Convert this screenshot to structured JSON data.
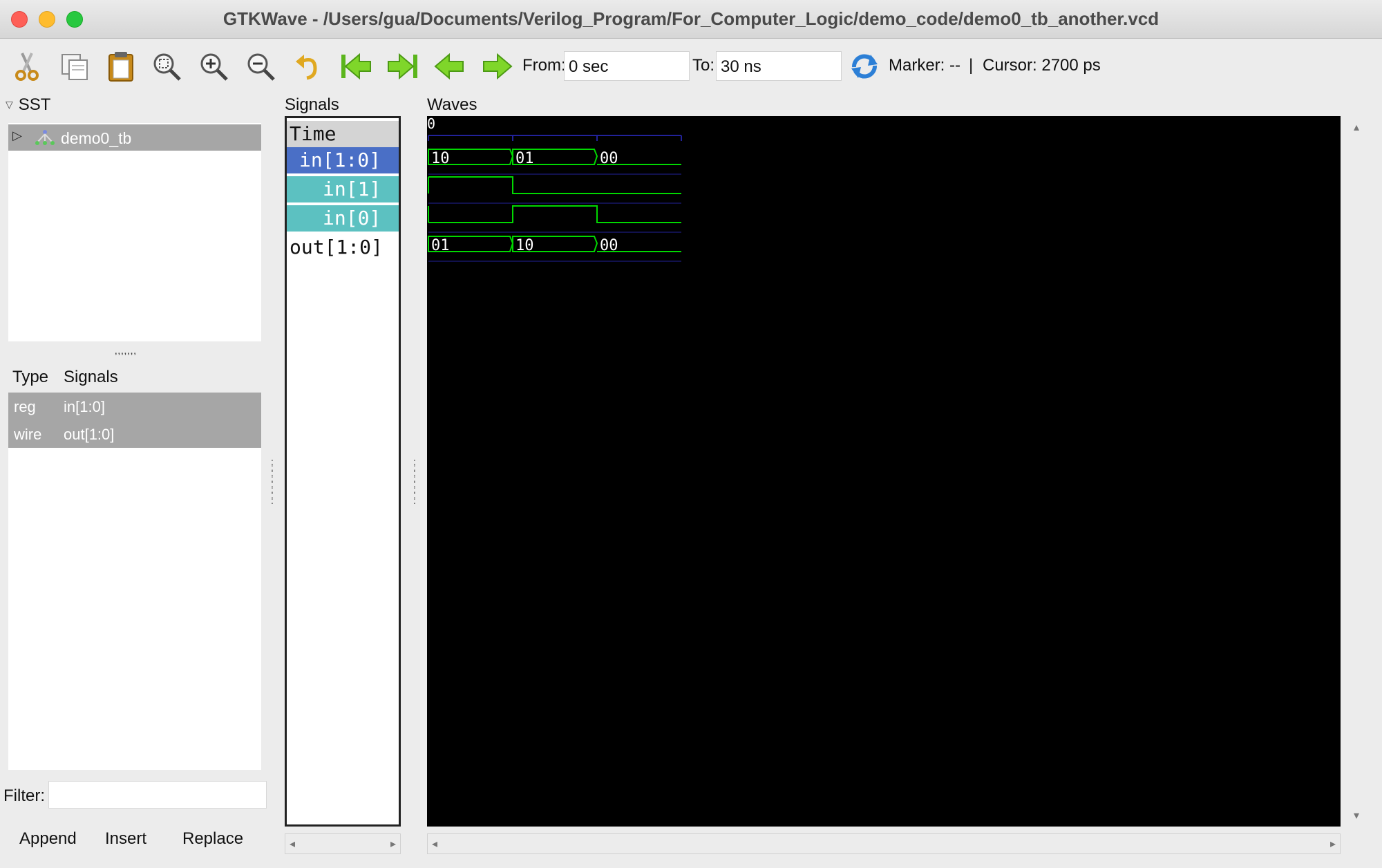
{
  "window": {
    "title": "GTKWave - /Users/gua/Documents/Verilog_Program/For_Computer_Logic/demo_code/demo0_tb_another.vcd"
  },
  "toolbar": {
    "icons": [
      "cut-icon",
      "copy-icon",
      "paste-icon",
      "zoom-fit-icon",
      "zoom-in-icon",
      "zoom-out-icon",
      "undo-icon",
      "jump-start-icon",
      "jump-end-icon",
      "prev-edge-icon",
      "next-edge-icon",
      "reload-icon"
    ],
    "from_label": "From:",
    "from_value": "0 sec",
    "to_label": "To:",
    "to_value": "30 ns",
    "marker_text": "Marker: --",
    "separator": "|",
    "cursor_text": "Cursor: 2700 ps"
  },
  "sst": {
    "header": "SST",
    "tree": [
      {
        "label": "demo0_tb"
      }
    ],
    "type_header": "Type",
    "signals_header": "Signals",
    "rows": [
      {
        "type": "reg",
        "signal": "in[1:0]"
      },
      {
        "type": "wire",
        "signal": "out[1:0]"
      }
    ],
    "filter_label": "Filter:",
    "filter_value": "",
    "buttons": {
      "append": "Append",
      "insert": "Insert",
      "replace": "Replace"
    }
  },
  "signals_pane": {
    "header": "Signals",
    "rows": [
      "Time",
      "in[1:0]",
      "in[1]",
      "in[0]",
      "out[1:0]"
    ]
  },
  "waves_pane": {
    "header": "Waves",
    "time_origin_label": "0",
    "colors": {
      "wave": "#00d800",
      "grid": "#22229a",
      "background": "#000000",
      "selected_row": "#4a6fc6",
      "child_row": "#5cc1c1"
    },
    "traces": [
      {
        "name": "in[1:0]",
        "kind": "bus",
        "values": [
          "10",
          "01",
          "00"
        ]
      },
      {
        "name": "in[1]",
        "kind": "bit",
        "levels": [
          1,
          0,
          0
        ]
      },
      {
        "name": "in[0]",
        "kind": "bit",
        "levels": [
          0,
          1,
          0
        ]
      },
      {
        "name": "out[1:0]",
        "kind": "bus",
        "values": [
          "01",
          "10",
          "00"
        ]
      }
    ]
  }
}
